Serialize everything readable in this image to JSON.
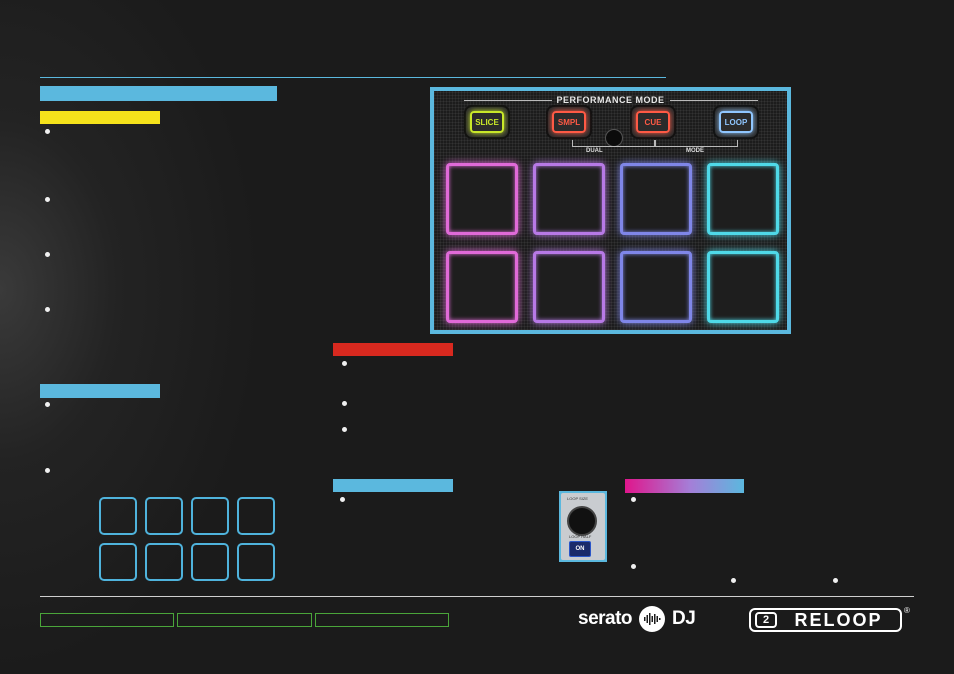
{
  "performance_mode": {
    "title": "PERFORMANCE MODE",
    "buttons": [
      {
        "label": "SLICE",
        "color": "#c9e829"
      },
      {
        "label": "SMPL",
        "color": "#ff5a45"
      },
      {
        "label": "CUE",
        "color": "#ff5a45"
      },
      {
        "label": "LOOP",
        "color": "#8fc6ff"
      }
    ],
    "dual_label": "DUAL",
    "mode_label": "MODE",
    "pad_colors": [
      "#e06ad8",
      "#b779e6",
      "#7f86e8",
      "#4fd9e8",
      "#e06ad8",
      "#b779e6",
      "#7f86e8",
      "#4fd9e8"
    ]
  },
  "loop_control": {
    "title": "LOOP SIZE",
    "sub": "LOOP HALF",
    "on_label": "ON"
  },
  "footer": {
    "serato_word": "serato",
    "dj_word": "DJ",
    "reloop_word": "RELOOP",
    "registered": "®"
  },
  "colors": {
    "blue": "#5bb8de",
    "yellow": "#f5e21b",
    "red": "#d8291f",
    "green": "#4aa53a",
    "magenta": "#e0168c"
  }
}
